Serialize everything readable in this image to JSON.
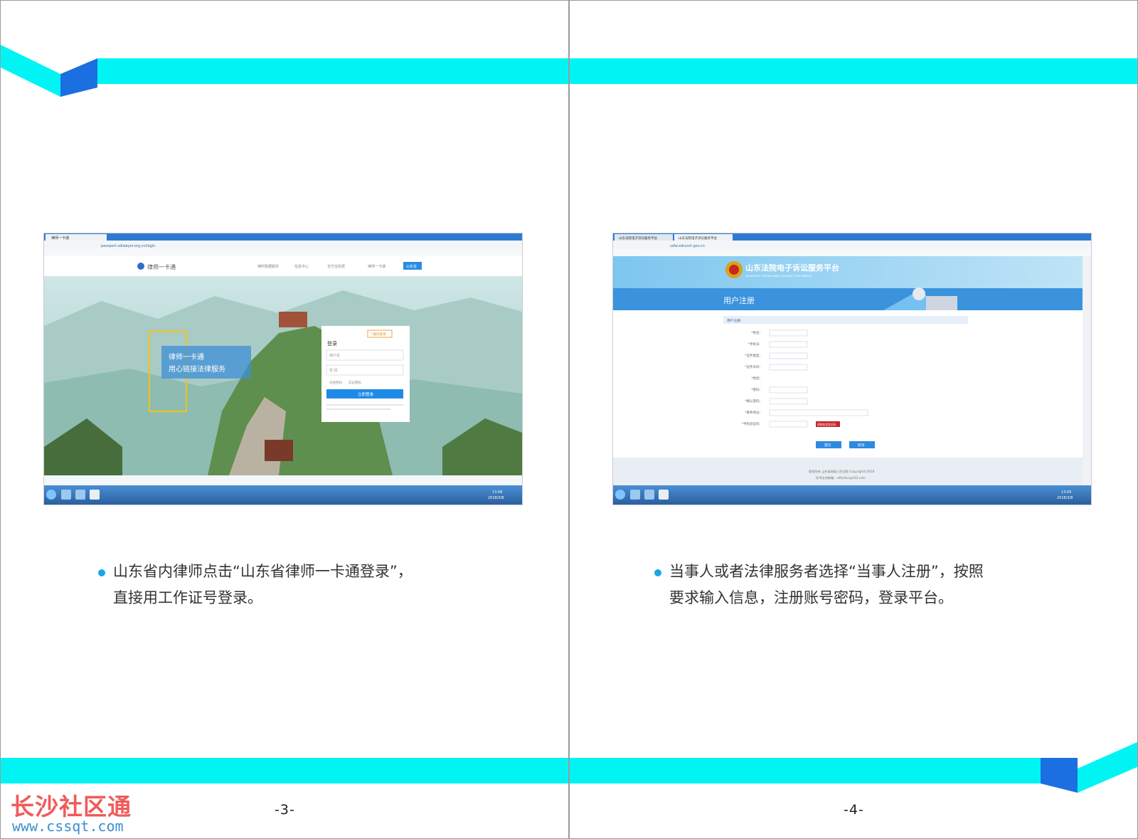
{
  "colors": {
    "cyan_band": "#00f4f4",
    "blue_accent": "#1b6fe0",
    "bullet": "#18a6e6",
    "caption_text": "#333333",
    "watermark_red": "#f15a5a",
    "watermark_blue": "#3a8fd0"
  },
  "left_page": {
    "screenshot": {
      "tab_title": "律师一卡通",
      "address": "passport.sdlawyer.org.cn/login",
      "site_logo": "律师一卡通",
      "nav_items": [
        "律所数据服务",
        "信息中心",
        "支付宝收费",
        "律师一卡通",
        "山东省"
      ],
      "hero_line1": "律师一卡通",
      "hero_line2": "用心链接法律服务",
      "login_title": "登录",
      "login_badge": "二维码登录",
      "user_placeholder": "用户名",
      "password_placeholder": "密 码",
      "remember_text": "记住密码",
      "forgot_text": "忘记密码",
      "login_button": "立即登录",
      "time": "13:08",
      "date": "2018/3/8"
    },
    "caption_line1": "山东省内律师点击“山东省律师一卡通登录”，",
    "caption_line2": "直接用工作证号登录。",
    "page_number": "-3-"
  },
  "right_page": {
    "screenshot": {
      "tab1_title": "山东法院电子诉讼服务平台",
      "tab2_title": "山东法院电子诉讼服务平台",
      "address": "ssfw.sdcourt.gov.cn",
      "portal_title": "山东法院电子诉讼服务平台",
      "portal_subtitle": "SHANDONG FAYUAN DIANZI SUSONG FUWU PINGTAI",
      "banner_title": "用户注册",
      "section_title": "用户注册",
      "form_labels": [
        "*姓名：",
        "*手机号：",
        "*证件类型：",
        "*证件号码：",
        "*性别：",
        "*密码：",
        "*确认密码：",
        "*联系地址：",
        "*手机验证码："
      ],
      "verify_button": "获取短信验证码",
      "submit_button": "提交",
      "cancel_button": "取消",
      "footer_line1": "版权所有 山东省高级人民法院 Copyright©2018",
      "footer_line2": "技术支持邮箱：sdfydzss@163.com",
      "time": "13:05",
      "date": "2018/3/8"
    },
    "caption_line1": "当事人或者法律服务者选择“当事人注册”，按照",
    "caption_line2": "要求输入信息，注册账号密码，登录平台。",
    "page_number": "-4-"
  },
  "watermark": {
    "title": "长沙社区通",
    "url": "www.cssqt.com"
  }
}
